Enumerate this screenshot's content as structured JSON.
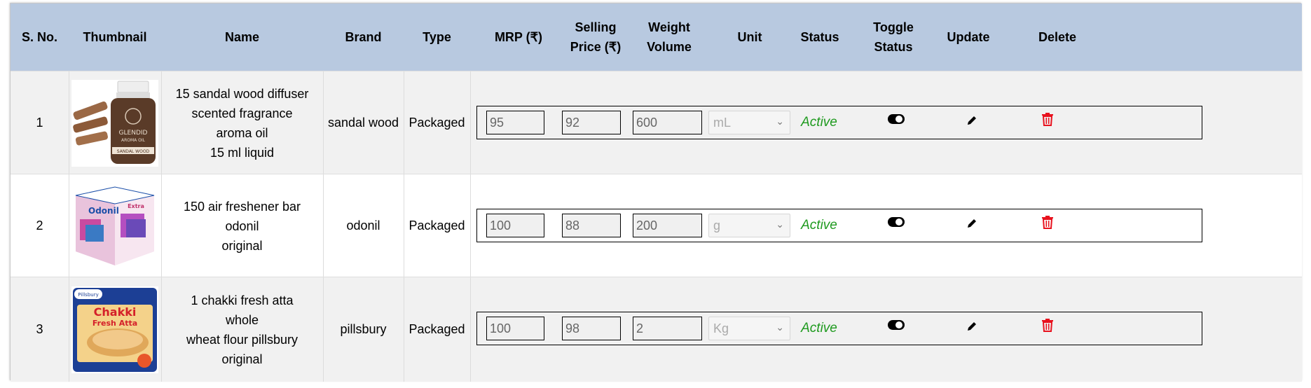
{
  "headers": {
    "sno": "S. No.",
    "thumbnail": "Thumbnail",
    "name": "Name",
    "brand": "Brand",
    "type": "Type",
    "mrp": "MRP (₹)",
    "selling_price_1": "Selling",
    "selling_price_2": "Price (₹)",
    "weight_1": "Weight",
    "weight_2": "Volume",
    "unit": "Unit",
    "status": "Status",
    "toggle_1": "Toggle",
    "toggle_2": "Status",
    "update": "Update",
    "delete": "Delete"
  },
  "rows": [
    {
      "sno": "1",
      "name_line1": "15 sandal wood diffuser",
      "name_line2": "scented fragrance aroma oil",
      "name_line3": "15 ml liquid",
      "brand": "sandal wood",
      "type": "Packaged",
      "mrp": "95",
      "selling_price": "92",
      "weight": "600",
      "unit": "mL",
      "status": "Active",
      "thumb_text": "GLENDID",
      "thumb_sub": "AROMA OIL",
      "thumb_band": "SANDAL WOOD"
    },
    {
      "sno": "2",
      "name_line1": "150 air freshener bar odonil",
      "name_line2": "original",
      "brand": "odonil",
      "type": "Packaged",
      "mrp": "100",
      "selling_price": "88",
      "weight": "200",
      "unit": "g",
      "status": "Active",
      "thumb_text": "Odonil",
      "thumb_sub": "Extra"
    },
    {
      "sno": "3",
      "name_line1": "1 chakki fresh atta whole",
      "name_line2": "wheat flour pillsbury original",
      "brand": "pillsbury",
      "type": "Packaged",
      "mrp": "100",
      "selling_price": "98",
      "weight": "2",
      "unit": "Kg",
      "status": "Active",
      "thumb_text": "Chakki",
      "thumb_sub": "Fresh Atta",
      "thumb_brand": "Pillsbury"
    }
  ],
  "colors": {
    "header_bg": "#b8c9e0",
    "row_alt_bg": "#f1f1f1",
    "status_active": "#1f9a1f",
    "delete_red": "#e8121e"
  },
  "icons": {
    "toggle": "toggle-on-icon",
    "update": "pencil-icon",
    "delete": "trash-icon",
    "dropdown": "chevron-down-icon"
  }
}
